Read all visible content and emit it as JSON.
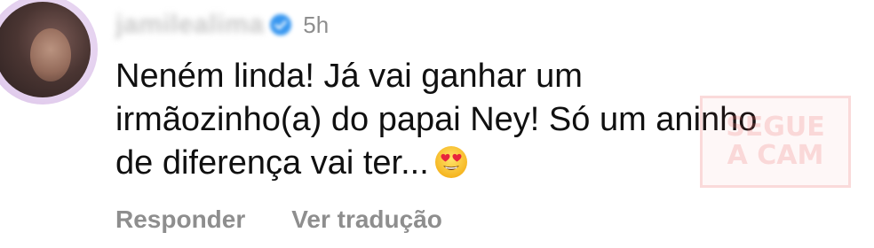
{
  "comment": {
    "username": "jamilealima",
    "time": "5h",
    "text_lines": [
      "Neném linda! Já vai ganhar um",
      "irmãozinho(a) do papai Ney! Só um aninho",
      "de diferença vai ter..."
    ],
    "emoji": "smiling-face-with-heart-eyes",
    "actions": {
      "reply": "Responder",
      "translate": "Ver tradução"
    }
  },
  "watermark": {
    "line1": "SEGUE",
    "line2": "A CAM"
  },
  "colors": {
    "text": "#101010",
    "muted": "#8e8e8e",
    "verified": "#3897f0",
    "avatar_ring": "#e6d3f0"
  }
}
